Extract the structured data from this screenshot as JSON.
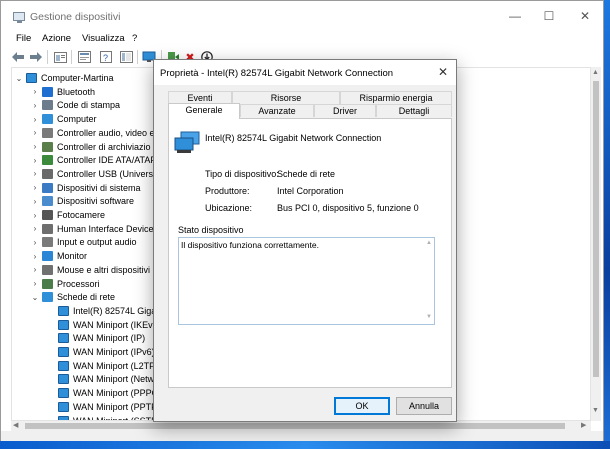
{
  "window": {
    "title": "Gestione dispositivi",
    "minimize": "—",
    "maximize": "☐",
    "close": "✕"
  },
  "menu": [
    "File",
    "Azione",
    "Visualizza",
    "?"
  ],
  "toolbar": {
    "icons": [
      "back-arrow-icon",
      "forward-arrow-icon",
      "properties-panel-icon",
      "help-icon",
      "console-tree-icon",
      "scan-hardware-icon",
      "enable-device-icon",
      "uninstall-device-icon",
      "update-driver-icon"
    ],
    "uninstall_glyph": "✖",
    "update_glyph": "⬇"
  },
  "tree": {
    "root": "Computer-Martina",
    "categories": [
      {
        "label": "Bluetooth",
        "color": "#1f6fd1"
      },
      {
        "label": "Code di stampa",
        "color": "#6d7c8c"
      },
      {
        "label": "Computer",
        "color": "#2f8fd8"
      },
      {
        "label": "Controller audio, video e",
        "color": "#7a7a7a"
      },
      {
        "label": "Controller di archiviazio",
        "color": "#5a7f4a"
      },
      {
        "label": "Controller IDE ATA/ATAPI",
        "color": "#3c8a3c"
      },
      {
        "label": "Controller USB (Universa",
        "color": "#6a6a6a"
      },
      {
        "label": "Dispositivi di sistema",
        "color": "#3a7bc4"
      },
      {
        "label": "Dispositivi software",
        "color": "#4b8ccf"
      },
      {
        "label": "Fotocamere",
        "color": "#555555"
      },
      {
        "label": "Human Interface Device",
        "color": "#6e6e6e"
      },
      {
        "label": "Input e output audio",
        "color": "#7a7a7a"
      },
      {
        "label": "Monitor",
        "color": "#2b86d6"
      },
      {
        "label": "Mouse e altri dispositivi",
        "color": "#707070"
      },
      {
        "label": "Processori",
        "color": "#4a7d4a"
      }
    ],
    "expanded": {
      "label": "Schede di rete",
      "children": [
        "Intel(R) 82574L Gigab",
        "WAN Miniport (IKEv2",
        "WAN Miniport (IP)",
        "WAN Miniport (IPv6)",
        "WAN Miniport (L2TP)",
        "WAN Miniport (Netw",
        "WAN Miniport (PPPO",
        "WAN Miniport (PPTP",
        "WAN Miniport (SSTP"
      ]
    },
    "collapsed_arrow": "›",
    "expanded_arrow": "⌄"
  },
  "dialog": {
    "title": "Proprietà - Intel(R) 82574L Gigabit Network Connection",
    "close": "✕",
    "tabs_back": [
      "Eventi",
      "Risorse",
      "Risparmio energia"
    ],
    "tabs_front": [
      "Generale",
      "Avanzate",
      "Driver",
      "Dettagli"
    ],
    "active_tab": "Generale",
    "device_name": "Intel(R) 82574L Gigabit Network Connection",
    "properties": [
      {
        "label": "Tipo di dispositivo:",
        "value": "Schede di rete"
      },
      {
        "label": "Produttore:",
        "value": "Intel Corporation"
      },
      {
        "label": "Ubicazione:",
        "value": "Bus PCI 0, dispositivo 5, funzione 0"
      }
    ],
    "status_label": "Stato dispositivo",
    "status_text": "Il dispositivo funziona correttamente.",
    "ok": "OK",
    "cancel": "Annulla"
  }
}
